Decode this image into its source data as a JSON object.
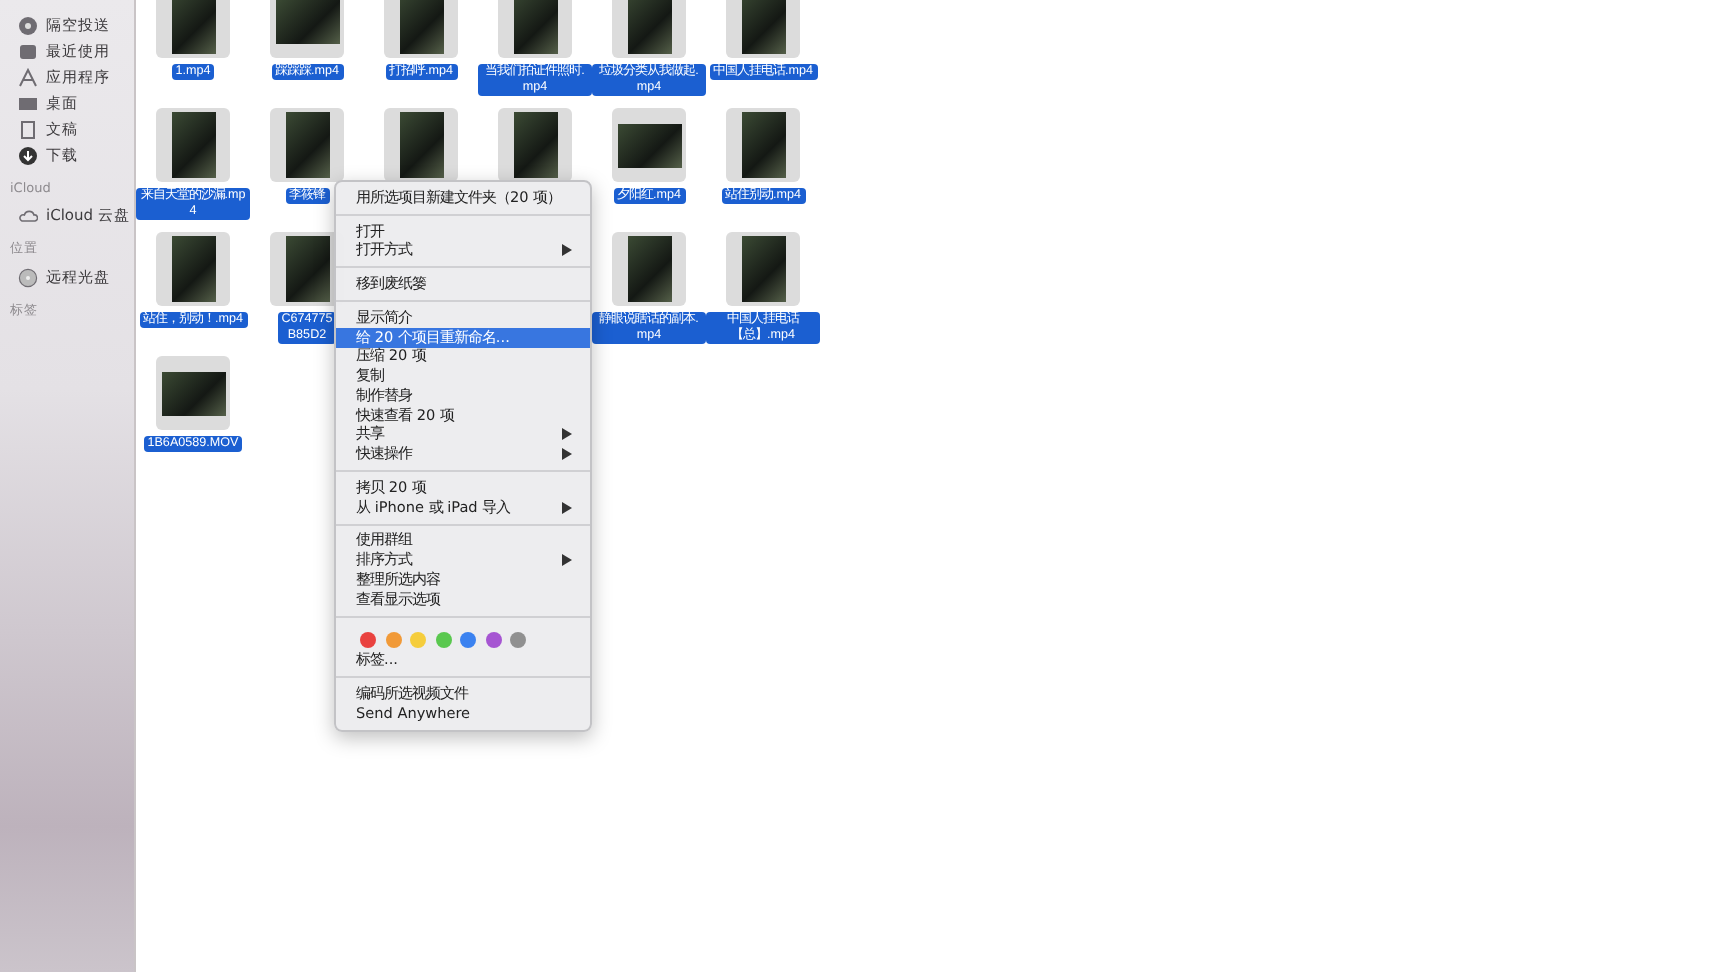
{
  "sidebar": {
    "sections": [
      {
        "items": [
          {
            "label": "隔空投送",
            "kind": "airdrop"
          },
          {
            "label": "最近使用",
            "kind": "recent"
          },
          {
            "label": "应用程序",
            "kind": "apps"
          },
          {
            "label": "桌面",
            "kind": "desktop"
          },
          {
            "label": "文稿",
            "kind": "docs"
          },
          {
            "label": "下载",
            "kind": "download"
          }
        ]
      },
      {
        "header": "iCloud",
        "items": [
          {
            "label": "iCloud 云盘",
            "kind": "cloud"
          }
        ]
      },
      {
        "header": "位置",
        "items": [
          {
            "label": "远程光盘",
            "kind": "disc"
          }
        ]
      },
      {
        "header": "标签"
      }
    ]
  },
  "files": [
    {
      "label": "1.mp4",
      "kind": "portrait",
      "selected": true
    },
    {
      "label": "踩踩踩.mp4",
      "kind": "landscape",
      "selected": true
    },
    {
      "label": "打招呼.mp4",
      "kind": "portrait",
      "selected": true
    },
    {
      "label": "当我们拍证件照时.mp4",
      "kind": "portrait",
      "selected": true
    },
    {
      "label": "垃圾分类从我做起.mp4",
      "kind": "portrait",
      "selected": true
    },
    {
      "label": "中国人挂电话.mp4",
      "kind": "portrait",
      "selected": true
    },
    {
      "label": "来自天堂的沙漏.mp4",
      "kind": "portrait",
      "selected": true
    },
    {
      "label": "李筱锋",
      "kind": "portrait",
      "selected": true
    },
    {
      "kind": "portrait",
      "selected": true
    },
    {
      "kind": "portrait",
      "selected": true
    },
    {
      "label": "夕阳红.mp4",
      "kind": "landscape",
      "selected": true
    },
    {
      "label": "站住别动.mp4",
      "kind": "portrait",
      "selected": true
    },
    {
      "label": "站住，别动！.mp4",
      "kind": "portrait",
      "selected": true
    },
    {
      "label": "C674775\nB85D2",
      "kind": "portrait",
      "selected": true
    },
    {
      "label": "静眼说瞎话的副本.mp4",
      "kind": "portrait",
      "selected": true
    },
    {
      "label": "中国人挂电话【总】.mp4",
      "kind": "portrait",
      "selected": true
    },
    {
      "label": "1B6A0589.MOV",
      "kind": "landscape",
      "selected": true
    }
  ],
  "context_menu": {
    "items": [
      {
        "kind": "item",
        "label": "用所选项目新建文件夹（20 项）",
        "submenu": false,
        "selected": false
      },
      {
        "kind": "separator"
      },
      {
        "kind": "item",
        "label": "打开",
        "submenu": false,
        "selected": false
      },
      {
        "kind": "item",
        "label": "打开方式",
        "submenu": true,
        "selected": false
      },
      {
        "kind": "separator"
      },
      {
        "kind": "item",
        "label": "移到废纸篓",
        "submenu": false,
        "selected": false
      },
      {
        "kind": "separator"
      },
      {
        "kind": "item",
        "label": "显示简介",
        "submenu": false,
        "selected": false
      },
      {
        "kind": "item",
        "label": "给 20 个项目重新命名...",
        "submenu": false,
        "selected": true
      },
      {
        "kind": "item",
        "label": "压缩 20 项",
        "submenu": false,
        "selected": false
      },
      {
        "kind": "item",
        "label": "复制",
        "submenu": false,
        "selected": false
      },
      {
        "kind": "item",
        "label": "制作替身",
        "submenu": false,
        "selected": false
      },
      {
        "kind": "item",
        "label": "快速查看 20 项",
        "submenu": false,
        "selected": false
      },
      {
        "kind": "item",
        "label": "共享",
        "submenu": true,
        "selected": false
      },
      {
        "kind": "item",
        "label": "快速操作",
        "submenu": true,
        "selected": false
      },
      {
        "kind": "separator"
      },
      {
        "kind": "item",
        "label": "拷贝 20 项",
        "submenu": false,
        "selected": false
      },
      {
        "kind": "item",
        "label": "从 iPhone 或 iPad 导入",
        "submenu": true,
        "selected": false
      },
      {
        "kind": "separator"
      },
      {
        "kind": "item",
        "label": "使用群组",
        "submenu": false,
        "selected": false
      },
      {
        "kind": "item",
        "label": "排序方式",
        "submenu": true,
        "selected": false
      },
      {
        "kind": "item",
        "label": "整理所选内容",
        "submenu": false,
        "selected": false
      },
      {
        "kind": "item",
        "label": "查看显示选项",
        "submenu": false,
        "selected": false
      },
      {
        "kind": "separator"
      },
      {
        "kind": "tags",
        "tags": [
          {
            "color": "#e9423f"
          },
          {
            "color": "#f19a38"
          },
          {
            "color": "#f5cd3c"
          },
          {
            "color": "#5ac84f"
          },
          {
            "color": "#3b82f0"
          },
          {
            "color": "#a655d2"
          },
          {
            "color": "#909090"
          }
        ]
      },
      {
        "kind": "item",
        "label": "标签...",
        "submenu": false,
        "selected": false
      },
      {
        "kind": "separator"
      },
      {
        "kind": "item",
        "label": "编码所选视频文件",
        "submenu": false,
        "selected": false
      },
      {
        "kind": "item",
        "label": "Send Anywhere",
        "submenu": false,
        "selected": false
      }
    ]
  }
}
